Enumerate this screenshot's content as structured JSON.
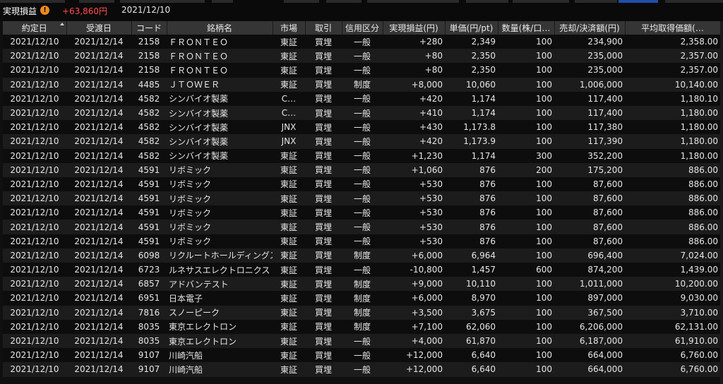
{
  "header": {
    "label": "実現損益",
    "warn_icon": "!",
    "total": "+63,860円",
    "date": "2021/12/10"
  },
  "columns": [
    "約定日",
    "受渡日",
    "コード",
    "銘柄名",
    "市場",
    "取引",
    "信用区分",
    "実現損益(円)",
    "単価(円/pt)",
    "数量(株/口…",
    "売却/決済額(円)",
    "平均取得価額(…"
  ],
  "rows": [
    {
      "trade_date": "2021/12/10",
      "settle_date": "2021/12/14",
      "code": "2158",
      "name": "ＦＲＯＮＴＥＯ",
      "market": "東証",
      "type": "買埋",
      "margin": "一般",
      "pl": "+280",
      "price": "2,349",
      "qty": "100",
      "amount": "234,900",
      "avg": "2,358.00"
    },
    {
      "trade_date": "2021/12/10",
      "settle_date": "2021/12/14",
      "code": "2158",
      "name": "ＦＲＯＮＴＥＯ",
      "market": "東証",
      "type": "買埋",
      "margin": "一般",
      "pl": "+80",
      "price": "2,350",
      "qty": "100",
      "amount": "235,000",
      "avg": "2,357.00"
    },
    {
      "trade_date": "2021/12/10",
      "settle_date": "2021/12/14",
      "code": "2158",
      "name": "ＦＲＯＮＴＥＯ",
      "market": "東証",
      "type": "買埋",
      "margin": "一般",
      "pl": "+80",
      "price": "2,350",
      "qty": "100",
      "amount": "235,000",
      "avg": "2,357.00"
    },
    {
      "trade_date": "2021/12/10",
      "settle_date": "2021/12/14",
      "code": "4485",
      "name": "ＪＴＯＷＥＲ",
      "market": "東証",
      "type": "買埋",
      "margin": "制度",
      "pl": "+8,000",
      "price": "10,060",
      "qty": "100",
      "amount": "1,006,000",
      "avg": "10,140.00"
    },
    {
      "trade_date": "2021/12/10",
      "settle_date": "2021/12/14",
      "code": "4582",
      "name": "シンバイオ製薬",
      "market": "C…",
      "type": "買埋",
      "margin": "一般",
      "pl": "+420",
      "price": "1,174",
      "qty": "100",
      "amount": "117,400",
      "avg": "1,180.10"
    },
    {
      "trade_date": "2021/12/10",
      "settle_date": "2021/12/14",
      "code": "4582",
      "name": "シンバイオ製薬",
      "market": "C…",
      "type": "買埋",
      "margin": "一般",
      "pl": "+410",
      "price": "1,174",
      "qty": "100",
      "amount": "117,400",
      "avg": "1,180.00"
    },
    {
      "trade_date": "2021/12/10",
      "settle_date": "2021/12/14",
      "code": "4582",
      "name": "シンバイオ製薬",
      "market": "JNX",
      "type": "買埋",
      "margin": "一般",
      "pl": "+430",
      "price": "1,173.8",
      "qty": "100",
      "amount": "117,380",
      "avg": "1,180.00"
    },
    {
      "trade_date": "2021/12/10",
      "settle_date": "2021/12/14",
      "code": "4582",
      "name": "シンバイオ製薬",
      "market": "JNX",
      "type": "買埋",
      "margin": "一般",
      "pl": "+420",
      "price": "1,173.9",
      "qty": "100",
      "amount": "117,390",
      "avg": "1,180.00"
    },
    {
      "trade_date": "2021/12/10",
      "settle_date": "2021/12/14",
      "code": "4582",
      "name": "シンバイオ製薬",
      "market": "東証",
      "type": "買埋",
      "margin": "一般",
      "pl": "+1,230",
      "price": "1,174",
      "qty": "300",
      "amount": "352,200",
      "avg": "1,180.00"
    },
    {
      "trade_date": "2021/12/10",
      "settle_date": "2021/12/14",
      "code": "4591",
      "name": "リボミック",
      "market": "東証",
      "type": "買埋",
      "margin": "一般",
      "pl": "+1,060",
      "price": "876",
      "qty": "200",
      "amount": "175,200",
      "avg": "886.00"
    },
    {
      "trade_date": "2021/12/10",
      "settle_date": "2021/12/14",
      "code": "4591",
      "name": "リボミック",
      "market": "東証",
      "type": "買埋",
      "margin": "一般",
      "pl": "+530",
      "price": "876",
      "qty": "100",
      "amount": "87,600",
      "avg": "886.00"
    },
    {
      "trade_date": "2021/12/10",
      "settle_date": "2021/12/14",
      "code": "4591",
      "name": "リボミック",
      "market": "東証",
      "type": "買埋",
      "margin": "一般",
      "pl": "+530",
      "price": "876",
      "qty": "100",
      "amount": "87,600",
      "avg": "886.00"
    },
    {
      "trade_date": "2021/12/10",
      "settle_date": "2021/12/14",
      "code": "4591",
      "name": "リボミック",
      "market": "東証",
      "type": "買埋",
      "margin": "一般",
      "pl": "+530",
      "price": "876",
      "qty": "100",
      "amount": "87,600",
      "avg": "886.00"
    },
    {
      "trade_date": "2021/12/10",
      "settle_date": "2021/12/14",
      "code": "4591",
      "name": "リボミック",
      "market": "東証",
      "type": "買埋",
      "margin": "一般",
      "pl": "+530",
      "price": "876",
      "qty": "100",
      "amount": "87,600",
      "avg": "886.00"
    },
    {
      "trade_date": "2021/12/10",
      "settle_date": "2021/12/14",
      "code": "4591",
      "name": "リボミック",
      "market": "東証",
      "type": "買埋",
      "margin": "一般",
      "pl": "+530",
      "price": "876",
      "qty": "100",
      "amount": "87,600",
      "avg": "886.00"
    },
    {
      "trade_date": "2021/12/10",
      "settle_date": "2021/12/14",
      "code": "6098",
      "name": "リクルートホールディングス",
      "market": "東証",
      "type": "買埋",
      "margin": "制度",
      "pl": "+6,000",
      "price": "6,964",
      "qty": "100",
      "amount": "696,400",
      "avg": "7,024.00"
    },
    {
      "trade_date": "2021/12/10",
      "settle_date": "2021/12/14",
      "code": "6723",
      "name": "ルネサスエレクトロニクス",
      "market": "東証",
      "type": "買埋",
      "margin": "一般",
      "pl": "-10,800",
      "price": "1,457",
      "qty": "600",
      "amount": "874,200",
      "avg": "1,439.00"
    },
    {
      "trade_date": "2021/12/10",
      "settle_date": "2021/12/14",
      "code": "6857",
      "name": "アドバンテスト",
      "market": "東証",
      "type": "買埋",
      "margin": "制度",
      "pl": "+9,000",
      "price": "10,110",
      "qty": "100",
      "amount": "1,011,000",
      "avg": "10,200.00"
    },
    {
      "trade_date": "2021/12/10",
      "settle_date": "2021/12/14",
      "code": "6951",
      "name": "日本電子",
      "market": "東証",
      "type": "買埋",
      "margin": "制度",
      "pl": "+6,000",
      "price": "8,970",
      "qty": "100",
      "amount": "897,000",
      "avg": "9,030.00"
    },
    {
      "trade_date": "2021/12/10",
      "settle_date": "2021/12/14",
      "code": "7816",
      "name": "スノーピーク",
      "market": "東証",
      "type": "買埋",
      "margin": "制度",
      "pl": "+3,500",
      "price": "3,675",
      "qty": "100",
      "amount": "367,500",
      "avg": "3,710.00"
    },
    {
      "trade_date": "2021/12/10",
      "settle_date": "2021/12/14",
      "code": "8035",
      "name": "東京エレクトロン",
      "market": "東証",
      "type": "買埋",
      "margin": "制度",
      "pl": "+7,100",
      "price": "62,060",
      "qty": "100",
      "amount": "6,206,000",
      "avg": "62,131.00"
    },
    {
      "trade_date": "2021/12/10",
      "settle_date": "2021/12/14",
      "code": "8035",
      "name": "東京エレクトロン",
      "market": "東証",
      "type": "買埋",
      "margin": "一般",
      "pl": "+4,000",
      "price": "61,870",
      "qty": "100",
      "amount": "6,187,000",
      "avg": "61,910.00"
    },
    {
      "trade_date": "2021/12/10",
      "settle_date": "2021/12/14",
      "code": "9107",
      "name": "川崎汽船",
      "market": "東証",
      "type": "買埋",
      "margin": "一般",
      "pl": "+12,000",
      "price": "6,640",
      "qty": "100",
      "amount": "664,000",
      "avg": "6,760.00"
    },
    {
      "trade_date": "2021/12/10",
      "settle_date": "2021/12/14",
      "code": "9107",
      "name": "川崎汽船",
      "market": "東証",
      "type": "買埋",
      "margin": "一般",
      "pl": "+12,000",
      "price": "6,640",
      "qty": "100",
      "amount": "664,000",
      "avg": "6,760.00"
    }
  ],
  "colors": {
    "positive": "#ff3b3b",
    "negative": "#3ccf3c",
    "buy": "#ff5a3c",
    "warn": "#f08a1c"
  }
}
